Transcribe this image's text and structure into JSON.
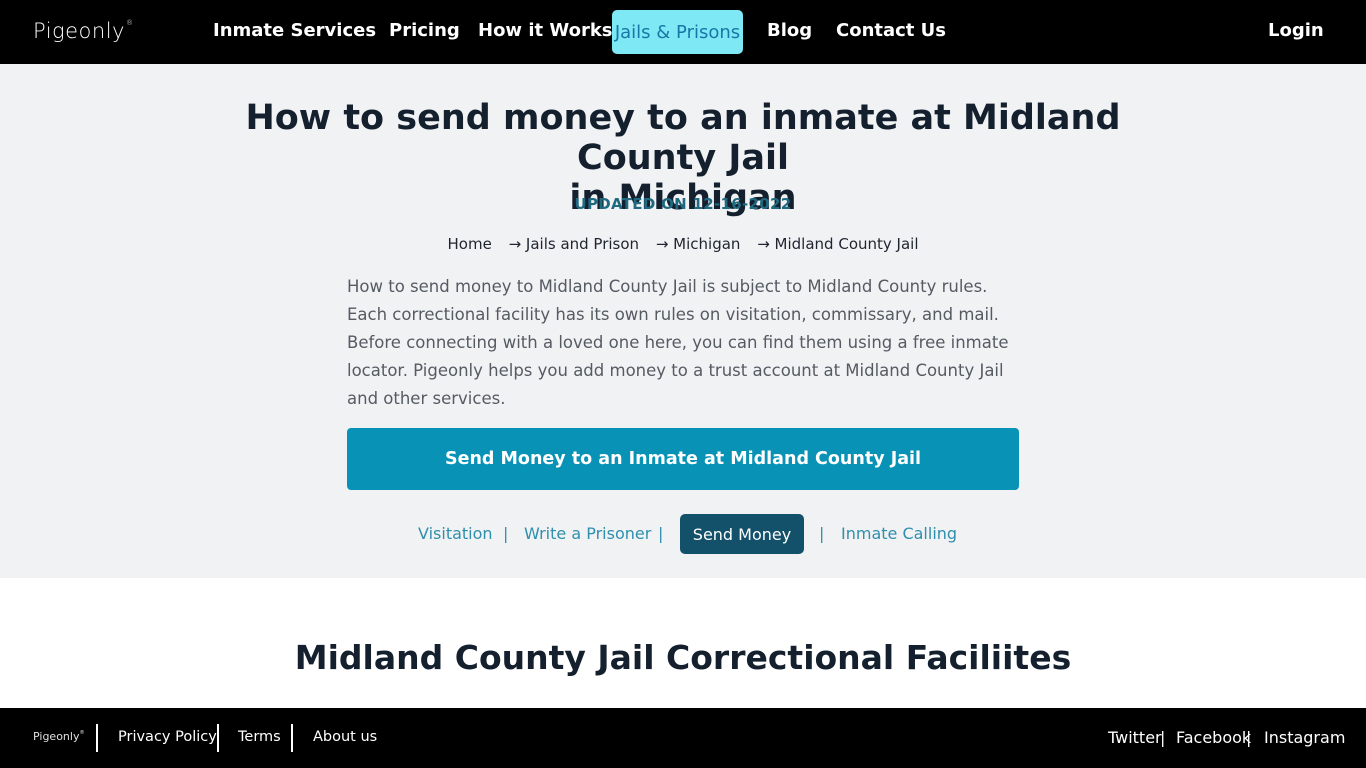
{
  "header": {
    "logo": "Pigeonly",
    "logo_mark": "®",
    "nav": [
      "Inmate Services",
      "Pricing",
      "How it Works",
      "Jails & Prisons",
      "Blog",
      "Contact Us"
    ],
    "login": "Login"
  },
  "hero": {
    "title_line1": "How to send money to an inmate at Midland County Jail",
    "title_line2": "in Michigan",
    "updated": "UPDATED ON 12-16-2022",
    "breadcrumb": [
      "Home",
      "→ Jails and Prison",
      "→ Michigan",
      "→ Midland County Jail"
    ],
    "intro": "How to send money to Midland County Jail is subject to Midland County rules. Each correctional facility has its own rules on visitation, commissary, and mail. Before connecting with a loved one here, you can find them using a free inmate locator. Pigeonly helps you add money to a trust account at Midland County Jail and other services.",
    "cta": "Send Money to an Inmate at Midland County Jail",
    "tabs": [
      "Visitation",
      "Write a Prisoner",
      "Send Money",
      "Inmate Calling"
    ],
    "separator": "|"
  },
  "section": {
    "title": "Midland County Jail Correctional Faciliites"
  },
  "footer": {
    "logo": "Pigeonly",
    "links": [
      "Privacy Policy",
      "Terms",
      "About us"
    ],
    "social": [
      "Twitter",
      "Facebook",
      "Instagram"
    ],
    "separator": "|"
  },
  "colors": {
    "nav_active_bg": "#7ee8f5",
    "cta_bg": "#0893b6",
    "tab_active_bg": "#13506a",
    "link": "#2f8fad"
  }
}
